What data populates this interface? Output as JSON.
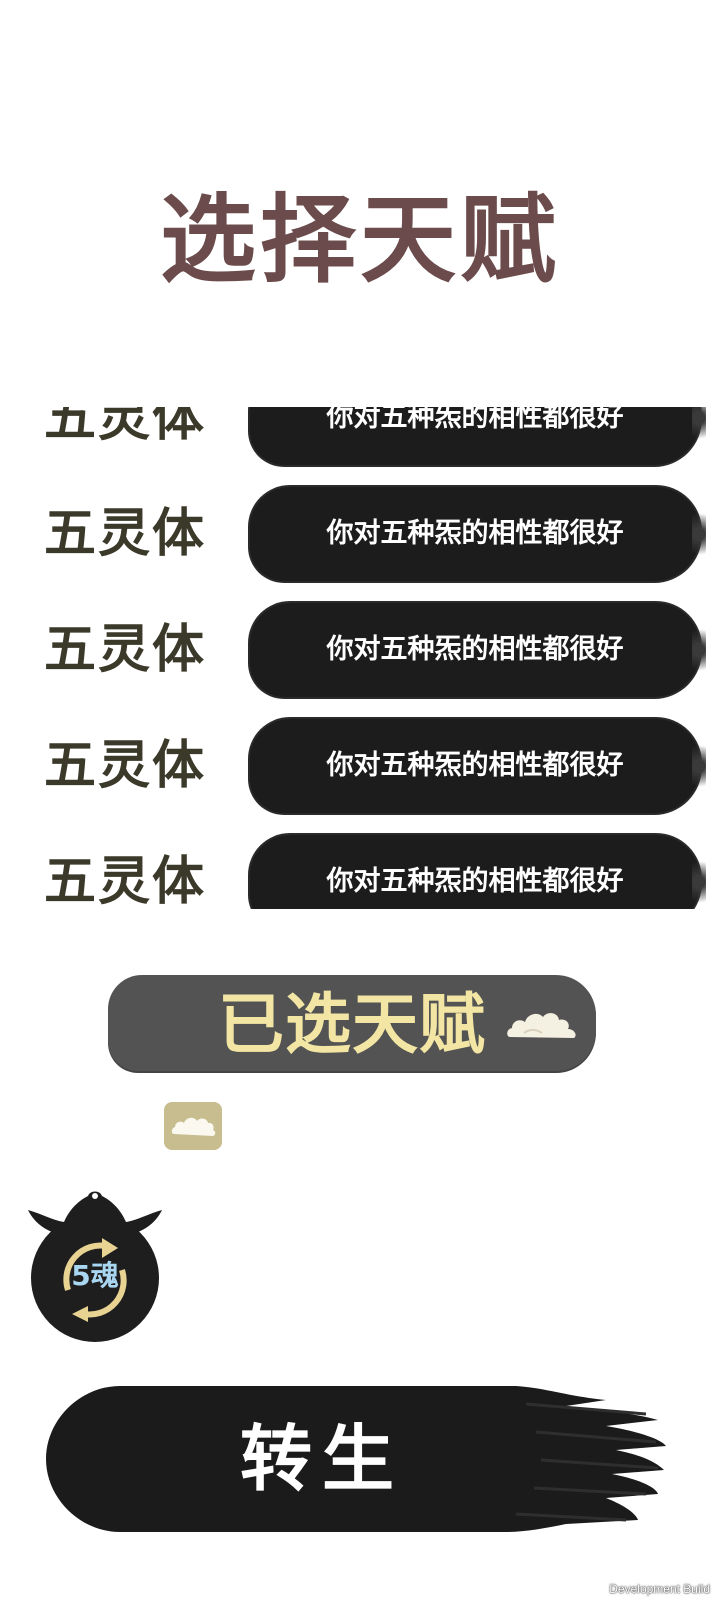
{
  "title": "选择天赋",
  "talents": [
    {
      "name": "五灵体",
      "description": "你对五种炁的相性都很好"
    },
    {
      "name": "五灵体",
      "description": "你对五种炁的相性都很好"
    },
    {
      "name": "五灵体",
      "description": "你对五种炁的相性都很好"
    },
    {
      "name": "五灵体",
      "description": "你对五种炁的相性都很好"
    },
    {
      "name": "五灵体",
      "description": "你对五种炁的相性都很好"
    }
  ],
  "selected": {
    "title": "已选天赋",
    "icon": "cloud-icon"
  },
  "selected_chip_icon": "cloud-icon",
  "soul_refresh": {
    "label": "5魂",
    "icon": "refresh-cycle-icon"
  },
  "reborn_button": {
    "label": "转生"
  },
  "footer": {
    "build_label": "Development Build"
  },
  "colors": {
    "title": "#6b4b4b",
    "talent_name": "#3b3a2a",
    "ink_bar": "#1c1c1c",
    "selected_bar": "#535353",
    "selected_text": "#f3e6a4",
    "chip": "#c8bd8e",
    "soul_text": "#a9d6f0",
    "refresh_arrows": "#e8d393"
  }
}
